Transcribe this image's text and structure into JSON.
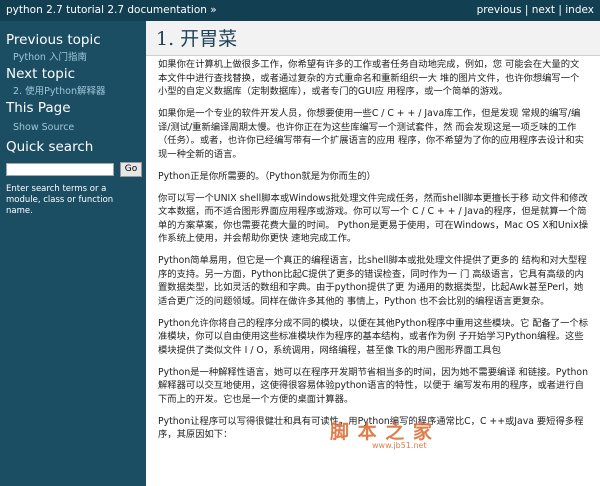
{
  "topbar": {
    "breadcrumb": "python 2.7 tutorial 2.7 documentation »",
    "previous": "previous",
    "next": "next",
    "index": "index",
    "separator": "|"
  },
  "sidebar": {
    "previous_topic_heading": "Previous topic",
    "previous_topic_link": "Python 入门指南",
    "next_topic_heading": "Next topic",
    "next_topic_link": "2. 使用Python解释器",
    "this_page_heading": "This Page",
    "show_source": "Show Source",
    "quick_search_heading": "Quick search",
    "search_value": "",
    "go_label": "Go",
    "search_hint": "Enter search terms or a module, class or function name."
  },
  "main": {
    "title": "1. 开胃菜",
    "paragraphs": [
      "如果你在计算机上做很多工作，你希望有许多的工作或者任务自动地完成，例如，您 可能会在大量的文本文件中进行查找替换，或者通过复杂的方式重命名和重新组织一大 堆的图片文件，也许你想编写一个小型的自定义数据库（定制数据库），或者专门的GUI应 用程序，或一个简单的游戏。",
      "如果你是一个专业的软件开发人员，你想要使用一些C / C + + / Java库工作，但是发现 常规的编写/编译/测试/重新编译周期太慢。也许你正在为这些库编写一个测试套件，然 而会发现这是一项乏味的工作（任务）。或者，也许你已经编写带有一个扩展语言的应用 程序，你不希望为了你的应用程序去设计和实现一种全新的语言。",
      "Python正是你所需要的。（Python就是为你而生的）",
      "你可以写一个UNIX shell脚本或Windows批处理文件完成任务，然而shell脚本更擅长于移 动文件和修改文本数据，而不适合图形界面应用程序或游戏。你可以写一个 C / C + + / Java的程序，但是就算一个简单的方案草案，你也需要花费大量的时间。 Python是更易于使用，可在Windows，Mac OS X和Unix操作系统上使用，并会帮助你更快 速地完成工作。",
      "Python简单易用，但它是一个真正的编程语言，比shell脚本或批处理文件提供了更多的 结构和对大型程序的支持。另一方面，Python比起C提供了更多的错误检查，同时作为一 门 高级语言，它具有高级的内置数据类型，比如灵活的数组和字典。由于python提供了更 为通用的数据类型，比起Awk甚至Perl，她适合更广泛的问题领域。同样在做许多其他的 事情上，Python 也不会比别的编程语言更复杂。",
      "Python允许你将自己的程序分成不同的模块，以便在其他Python程序中重用这些模块。它 配备了一个标准模块，你可以自由使用这些标准模块作为程序的基本结构，或者作为例 子开始学习Python编程。这些模块提供了类似文件 I / O，系统调用，网络编程，甚至像 Tk的用户图形界面工具包",
      "Python是一种解释性语言，她可以在程序开发期节省相当多的时间，因为她不需要编译 和链接。Python解释器可以交互地使用，这使得很容易体验python语言的特性，以便于 编写发布用的程序，或者进行自下而上的开发。它也是一个方便的桌面计算器。",
      "Python让程序可以写得很健壮和具有可读性，用Python编写的程序通常比C，C ++或Java 要短得多程序，其原因如下："
    ]
  },
  "watermark": {
    "text": "脚 本 之 家",
    "url": "www.jb51.net"
  }
}
